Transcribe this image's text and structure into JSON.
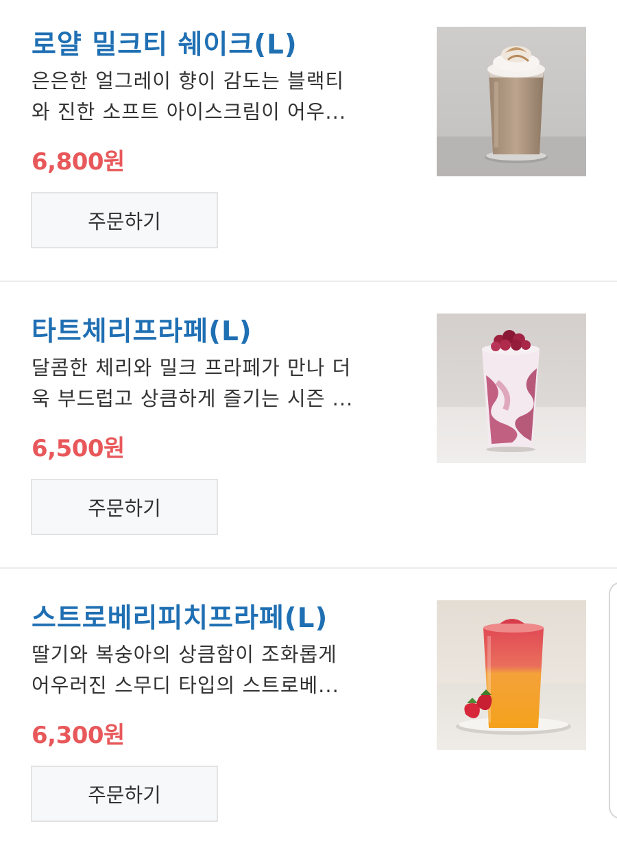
{
  "menu_items": [
    {
      "title": "로얄 밀크티 쉐이크(L)",
      "description_lines": [
        "은은한 얼그레이 향이 감도는 블랙티",
        "와 진한 소프트 아이스크림이 어우..."
      ],
      "price": "6,800원",
      "order_label": "주문하기",
      "image": "royal-milk-tea-shake-photo"
    },
    {
      "title": "타트체리프라페(L)",
      "description_lines": [
        "달콤한 체리와 밀크 프라페가 만나 더",
        "욱 부드럽고 상큼하게 즐기는 시즌 ..."
      ],
      "price": "6,500원",
      "order_label": "주문하기",
      "image": "tart-cherry-frappe-photo"
    },
    {
      "title": "스트로베리피치프라페(L)",
      "description_lines": [
        "딸기와 복숭아의 상큼함이 조화롭게",
        "어우러진 스무디 타입의 스트로베..."
      ],
      "price": "6,300원",
      "order_label": "주문하기",
      "image": "strawberry-peach-frappe-photo"
    }
  ],
  "colors": {
    "title": "#1f6fb3",
    "price": "#e8585a",
    "text": "#333333",
    "button_bg": "#f6f8fa",
    "button_border": "#e3e3e3",
    "divider": "#ebebeb"
  }
}
